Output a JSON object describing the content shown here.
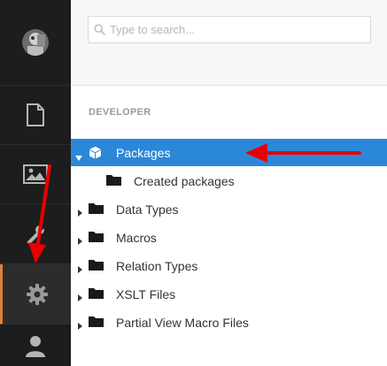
{
  "search": {
    "placeholder": "Type to search..."
  },
  "section": {
    "title": "DEVELOPER"
  },
  "rail": {
    "items": [
      {
        "icon": "avatar"
      },
      {
        "icon": "document-icon"
      },
      {
        "icon": "image-icon"
      },
      {
        "icon": "wrench-icon"
      },
      {
        "icon": "gear-icon",
        "active": true
      },
      {
        "icon": "user-icon"
      }
    ],
    "active_color": "#e0803d"
  },
  "tree": {
    "items": [
      {
        "label": "Packages",
        "icon": "package-icon",
        "expanded": true,
        "selected": true
      },
      {
        "label": "Created packages",
        "icon": "folder-icon",
        "indent": 1
      },
      {
        "label": "Data Types",
        "icon": "folder-icon"
      },
      {
        "label": "Macros",
        "icon": "folder-icon"
      },
      {
        "label": "Relation Types",
        "icon": "folder-icon"
      },
      {
        "label": "XSLT Files",
        "icon": "folder-icon"
      },
      {
        "label": "Partial View Macro Files",
        "icon": "folder-icon"
      }
    ],
    "selected_color": "#2b88d9"
  },
  "annotations": {
    "arrow_color": "#e60000"
  }
}
